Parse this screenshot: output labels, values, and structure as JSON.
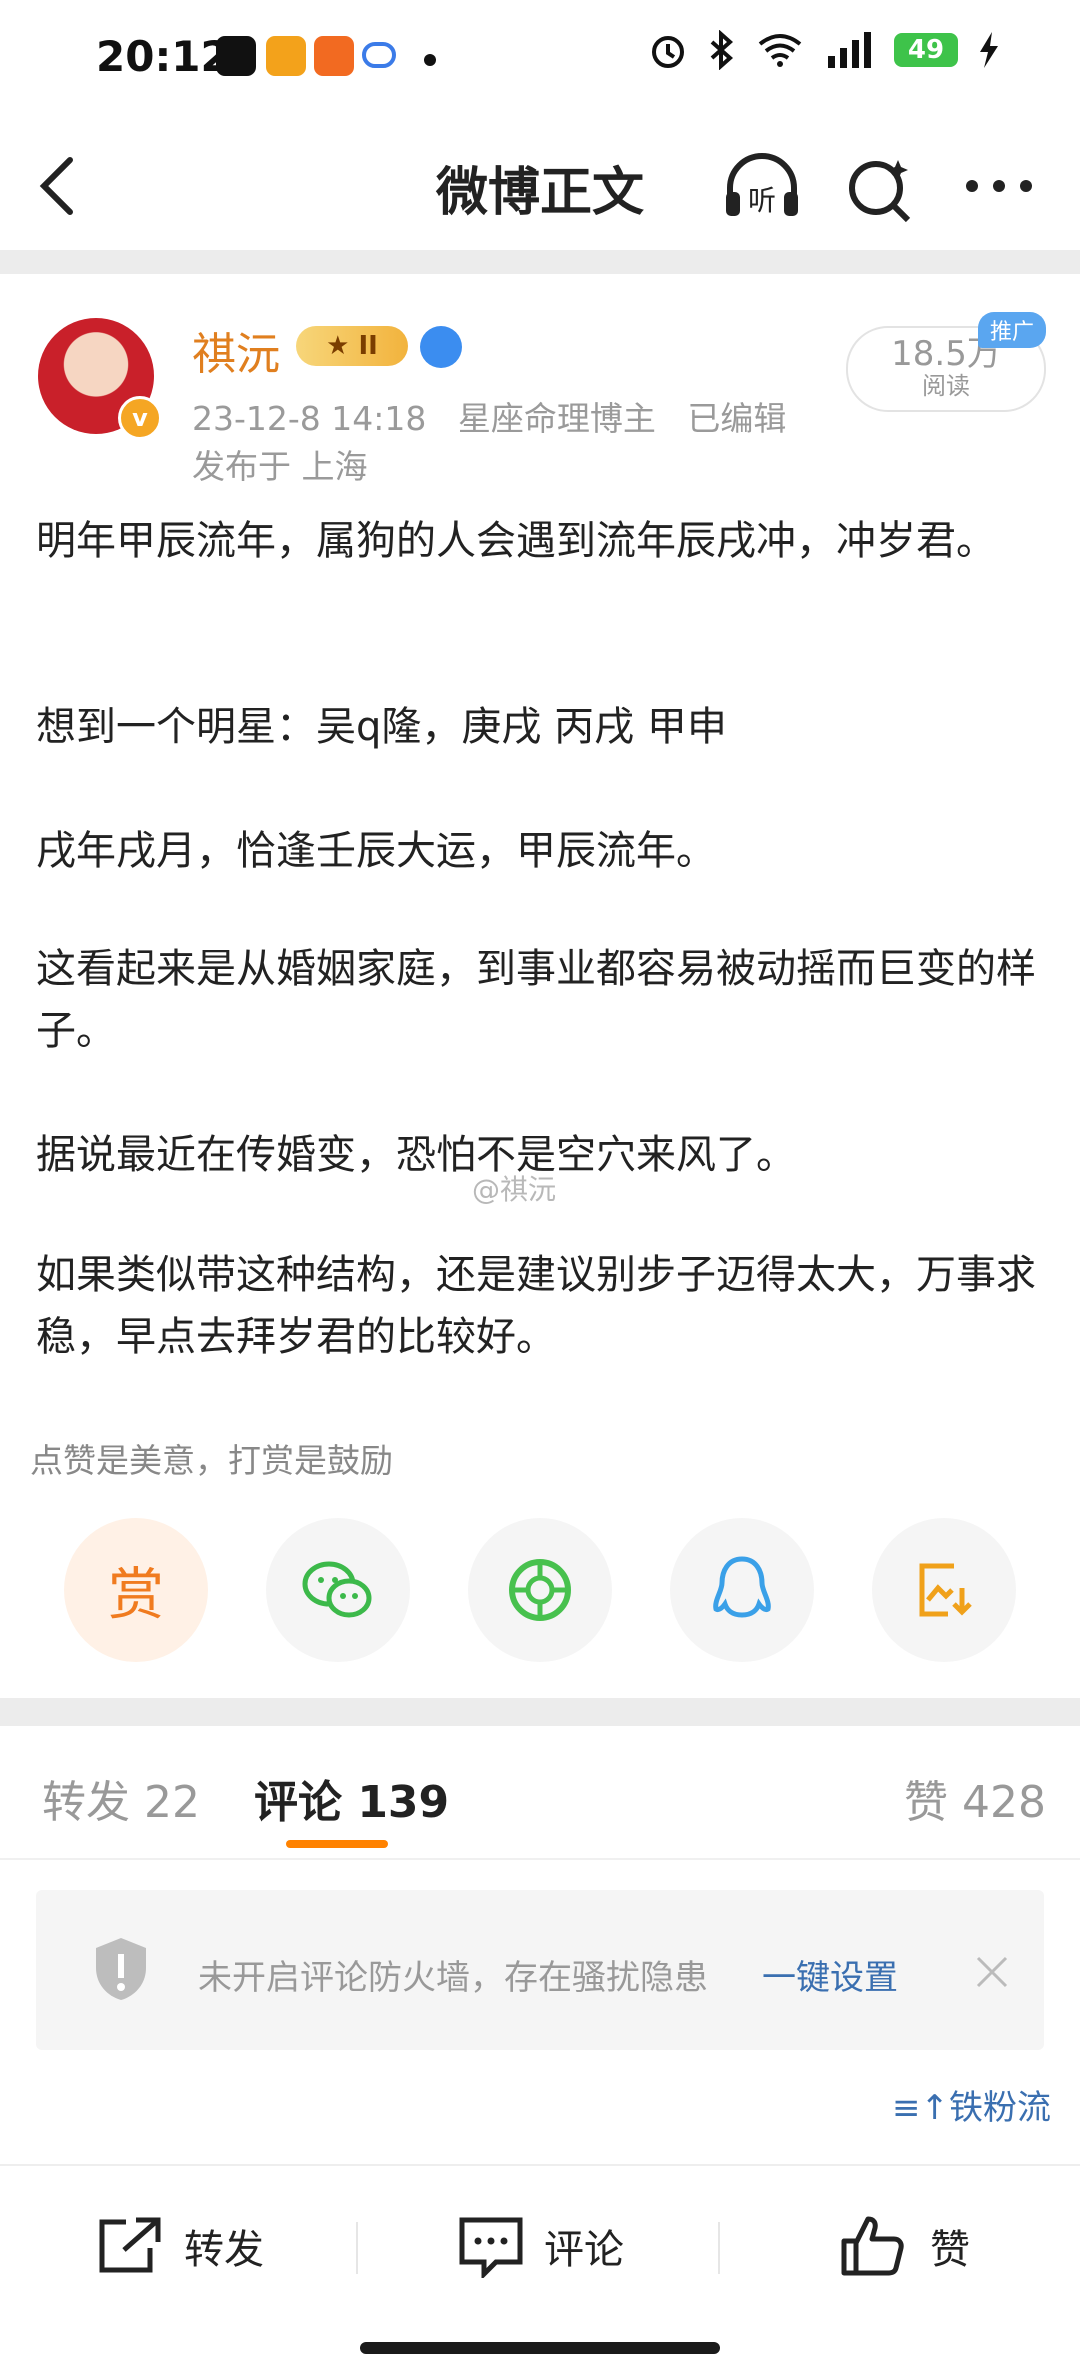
{
  "status_bar": {
    "time": "20:12",
    "battery": "49"
  },
  "nav": {
    "title": "微博正文"
  },
  "post": {
    "author": {
      "name": "祺沅",
      "level_badge": "II"
    },
    "reads": {
      "count": "18.5万",
      "label": "阅读"
    },
    "promo_badge": "推广",
    "meta": {
      "time": "23-12-8 14:18",
      "role": "星座命理博主",
      "edited": "已编辑",
      "location": "发布于 上海"
    },
    "paragraphs": [
      "明年甲辰流年，属狗的人会遇到流年辰戌冲，冲岁君。",
      "想到一个明星：吴q隆，庚戌 丙戌 甲申",
      "戌年戌月，恰逢壬辰大运，甲辰流年。",
      "这看起来是从婚姻家庭，到事业都容易被动摇而巨变的样子。",
      "据说最近在传婚变，恐怕不是空穴来风了。",
      "如果类似带这种结构，还是建议别步子迈得太大，万事求稳，早点去拜岁君的比较好。"
    ],
    "watermark": "@祺沅",
    "reward_hint": "点赞是美意，打赏是鼓励",
    "reward_label": "赏"
  },
  "tabs": {
    "repost": "转发 22",
    "comment": "评论 139",
    "like": "赞 428"
  },
  "notice": {
    "text": "未开启评论防火墙，存在骚扰隐患",
    "link": "一键设置"
  },
  "sort": {
    "label": "铁粉流"
  },
  "bottom_bar": {
    "repost": "转发",
    "comment": "评论",
    "like": "赞"
  }
}
